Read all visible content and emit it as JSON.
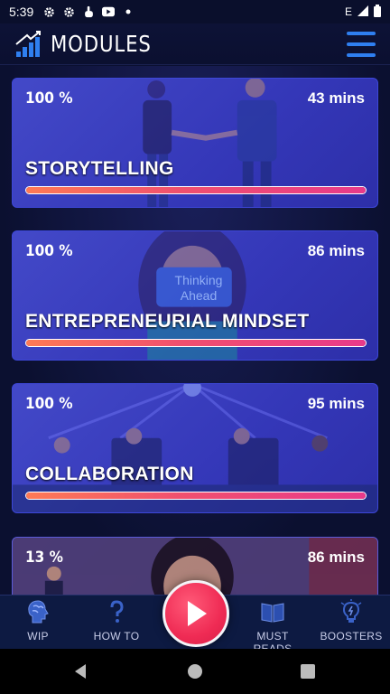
{
  "status_bar": {
    "time": "5:39",
    "network": "E"
  },
  "header": {
    "title": "MODULES"
  },
  "modules": [
    {
      "progress_label": "100 %",
      "progress": 1.0,
      "duration": "43 mins",
      "title": "STORYTELLING"
    },
    {
      "progress_label": "100 %",
      "progress": 1.0,
      "duration": "86 mins",
      "title": "ENTREPRENEURIAL MINDSET",
      "art_text": "Thinking Ahead"
    },
    {
      "progress_label": "100 %",
      "progress": 1.0,
      "duration": "95 mins",
      "title": "COLLABORATION"
    },
    {
      "progress_label": "13 %",
      "progress": 0.13,
      "duration": "86 mins",
      "title": ""
    }
  ],
  "bottom_nav": {
    "wip": "WIP",
    "how_to": "HOW TO",
    "must_reads": "MUST READS",
    "boosters": "BOOSTERS"
  },
  "colors": {
    "accent": "#2f7ff0",
    "play": "#ef2b54",
    "card": "#3d47d8"
  }
}
